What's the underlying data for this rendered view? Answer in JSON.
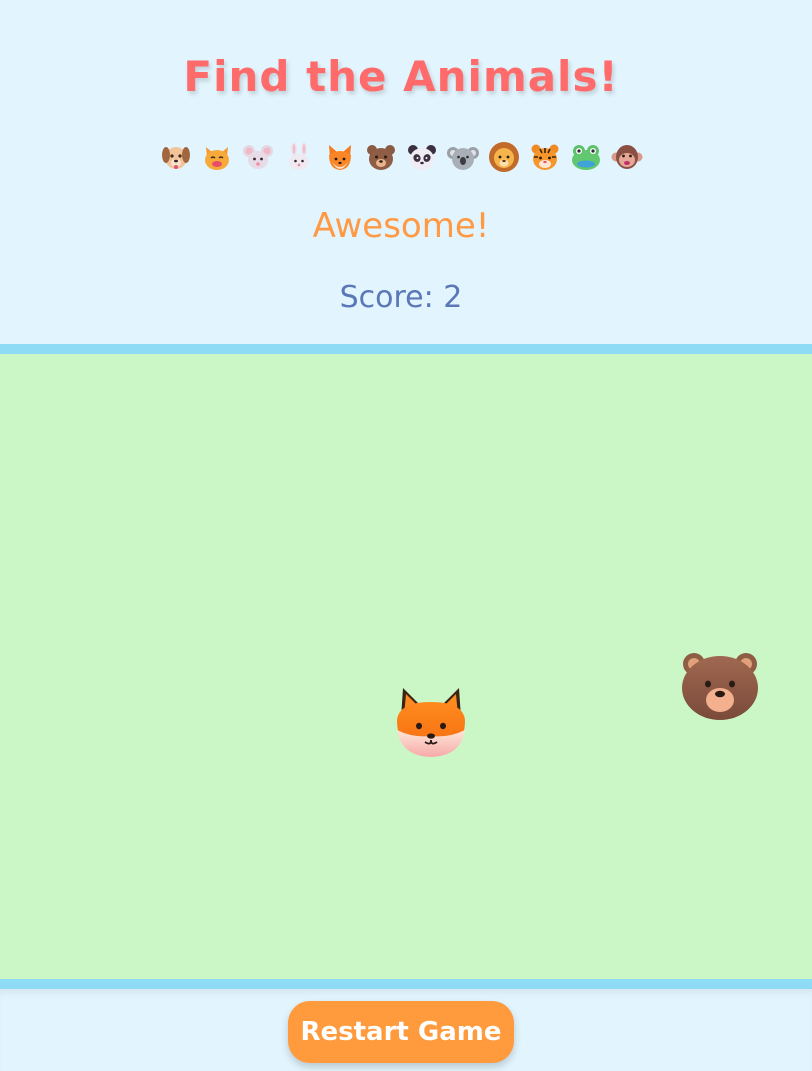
{
  "header": {
    "title": "Find the Animals!",
    "animals": [
      "dog",
      "cat",
      "mouse",
      "rabbit",
      "fox",
      "bear",
      "panda",
      "koala",
      "lion",
      "tiger",
      "frog",
      "monkey"
    ]
  },
  "status": {
    "message": "Awesome!",
    "score_text": "Score: 2"
  },
  "field": {
    "visible_animals": [
      "fox",
      "bear"
    ]
  },
  "footer": {
    "restart_label": "Restart Game"
  },
  "colors": {
    "title": "#ff6b6b",
    "message": "#ff9944",
    "score": "#5a78b8",
    "header_bg": "#e2f4fd",
    "field_bg": "#caf7c5",
    "field_border": "#8ddbf5",
    "button_bg": "#ff9a3d"
  }
}
